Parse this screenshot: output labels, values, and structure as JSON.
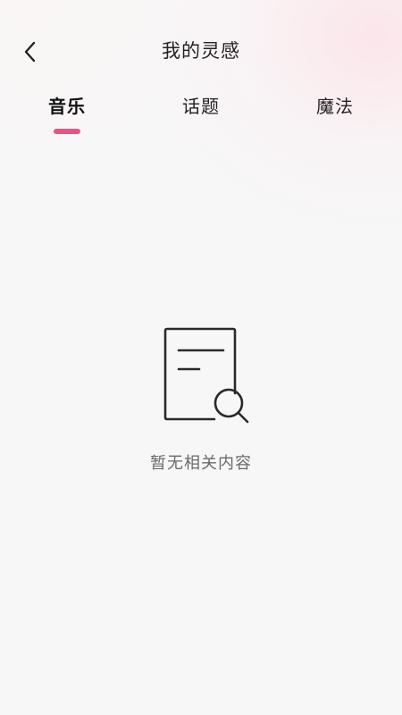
{
  "header": {
    "title": "我的灵感",
    "back_icon": "chevron-left-icon"
  },
  "tabs": [
    {
      "label": "音乐",
      "active": true
    },
    {
      "label": "话题",
      "active": false
    },
    {
      "label": "魔法",
      "active": false
    }
  ],
  "empty_state": {
    "icon": "document-search-icon",
    "message": "暂无相关内容"
  },
  "colors": {
    "accent": "#ee4f86",
    "text_primary": "#222222",
    "text_secondary": "#6a6a6a",
    "background": "#f7f7f7"
  }
}
